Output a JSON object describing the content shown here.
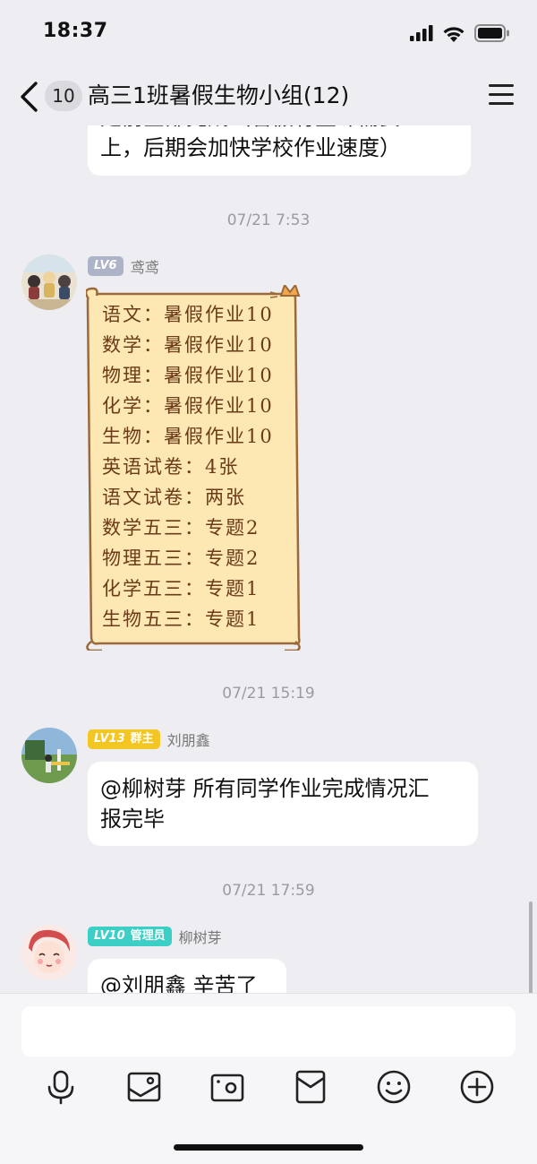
{
  "status_bar": {
    "time": "18:37"
  },
  "nav": {
    "unread_count": "10",
    "title": "高三1班暑假生物小组(12)"
  },
  "messages": {
    "partial": {
      "line1": "定前全部完成（暑假有些课需要",
      "line2": "上，后期会加快学校作业速度）"
    },
    "msg1": {
      "timestamp": "07/21 7:53",
      "level": "LV6",
      "sender": "鸢鸢",
      "lines": [
        "语文：暑假作业10",
        "数学：暑假作业10",
        "物理：暑假作业10",
        "化学：暑假作业10",
        "生物：暑假作业10",
        "英语试卷：4张",
        "语文试卷：两张",
        "数学五三：专题2",
        "物理五三：专题2",
        "化学五三：专题1",
        "生物五三：专题1"
      ]
    },
    "msg2": {
      "timestamp": "07/21 15:19",
      "level": "LV13",
      "role": "群主",
      "sender": "刘朋鑫",
      "line1": "@柳树芽 所有同学作业完成情况汇",
      "line2": "报完毕"
    },
    "msg3": {
      "timestamp": "07/21 17:59",
      "level": "LV10",
      "role": "管理员",
      "sender": "柳树芽",
      "text": "@刘朋鑫 辛苦了"
    }
  },
  "input": {
    "placeholder": ""
  },
  "toolbar": [
    "microphone-icon",
    "image-icon",
    "camera-icon",
    "red-packet-icon",
    "emoji-icon",
    "plus-icon"
  ],
  "colors": {
    "background": "#ededf2",
    "lv_gray": "#aeb4c8",
    "lv_gold": "#f3c623",
    "lv_teal": "#3ccfc6",
    "scroll_paper": "#fde8b4",
    "scroll_text": "#6b3a18"
  }
}
